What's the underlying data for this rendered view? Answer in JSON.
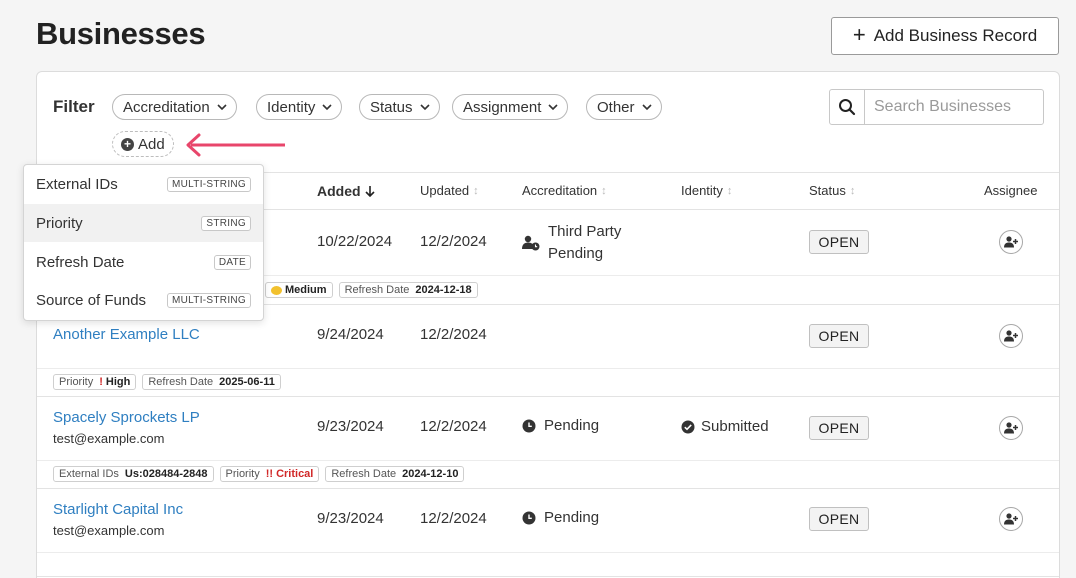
{
  "page": {
    "title": "Businesses",
    "add_button": "Add Business Record"
  },
  "filter": {
    "label": "Filter",
    "chips": [
      "Accreditation",
      "Identity",
      "Status",
      "Assignment",
      "Other"
    ],
    "add_label": "Add",
    "search_placeholder": "Search Businesses"
  },
  "columns": {
    "added": "Added",
    "updated": "Updated",
    "accreditation": "Accreditation",
    "identity": "Identity",
    "status": "Status",
    "assignee": "Assignee"
  },
  "dropdown": {
    "items": [
      {
        "label": "External IDs",
        "type": "MULTI-STRING"
      },
      {
        "label": "Priority",
        "type": "STRING"
      },
      {
        "label": "Refresh Date",
        "type": "DATE"
      },
      {
        "label": "Source of Funds",
        "type": "MULTI-STRING"
      }
    ]
  },
  "rows": [
    {
      "added": "10/22/2024",
      "updated": "12/2/2024",
      "accreditation_line1": "Third Party",
      "accreditation_line2": "Pending",
      "status": "OPEN",
      "meta": {
        "priority_value": "Medium",
        "refresh_label": "Refresh Date",
        "refresh_value": "2024-12-18"
      }
    },
    {
      "name": "Another Example LLC",
      "added": "9/24/2024",
      "updated": "12/2/2024",
      "status": "OPEN",
      "meta": {
        "priority_label": "Priority",
        "priority_value": "High",
        "refresh_label": "Refresh Date",
        "refresh_value": "2025-06-11"
      }
    },
    {
      "name": "Spacely Sprockets LP",
      "email": "test@example.com",
      "added": "9/23/2024",
      "updated": "12/2/2024",
      "accreditation": "Pending",
      "identity": "Submitted",
      "status": "OPEN",
      "meta": {
        "ext_label": "External IDs",
        "ext_value": "Us:028484-2848",
        "priority_label": "Priority",
        "priority_value": "Critical",
        "refresh_label": "Refresh Date",
        "refresh_value": "2024-12-10"
      }
    },
    {
      "name": "Starlight Capital Inc",
      "email": "test@example.com",
      "added": "9/23/2024",
      "updated": "12/2/2024",
      "accreditation": "Pending",
      "status": "OPEN"
    }
  ],
  "colors": {
    "link": "#2f7fc1",
    "arrow": "#e8466b",
    "critical": "#d12828",
    "medium": "#f2c12e"
  }
}
